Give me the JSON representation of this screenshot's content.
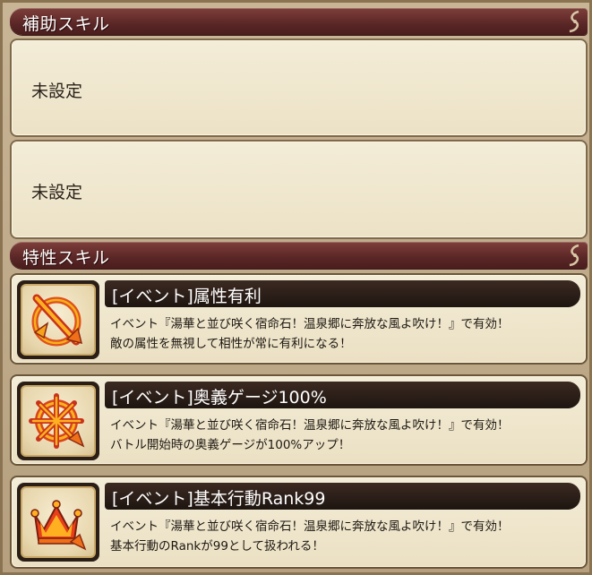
{
  "support_section": {
    "title": "補助スキル",
    "slots": [
      {
        "label": "未設定"
      },
      {
        "label": "未設定"
      }
    ]
  },
  "trait_section": {
    "title": "特性スキル",
    "skills": [
      {
        "icon": "attribute-advantage-icon",
        "title": "[イベント]属性有利",
        "desc_line1": "イベント『湯華と並び咲く宿命石！温泉郷に奔放な風よ吹け！』で有効！",
        "desc_line2": "敵の属性を無視して相性が常に有利になる！"
      },
      {
        "icon": "ougi-gauge-icon",
        "title": "[イベント]奥義ゲージ100%",
        "desc_line1": "イベント『湯華と並び咲く宿命石！温泉郷に奔放な風よ吹け！』で有効！",
        "desc_line2": "バトル開始時の奥義ゲージが100%アップ！"
      },
      {
        "icon": "crown-icon",
        "title": "[イベント]基本行動Rank99",
        "desc_line1": "イベント『湯華と並び咲く宿命石！温泉郷に奔放な風よ吹け！』で有効！",
        "desc_line2": "基本行動のRankが99として扱われる！"
      }
    ]
  }
}
